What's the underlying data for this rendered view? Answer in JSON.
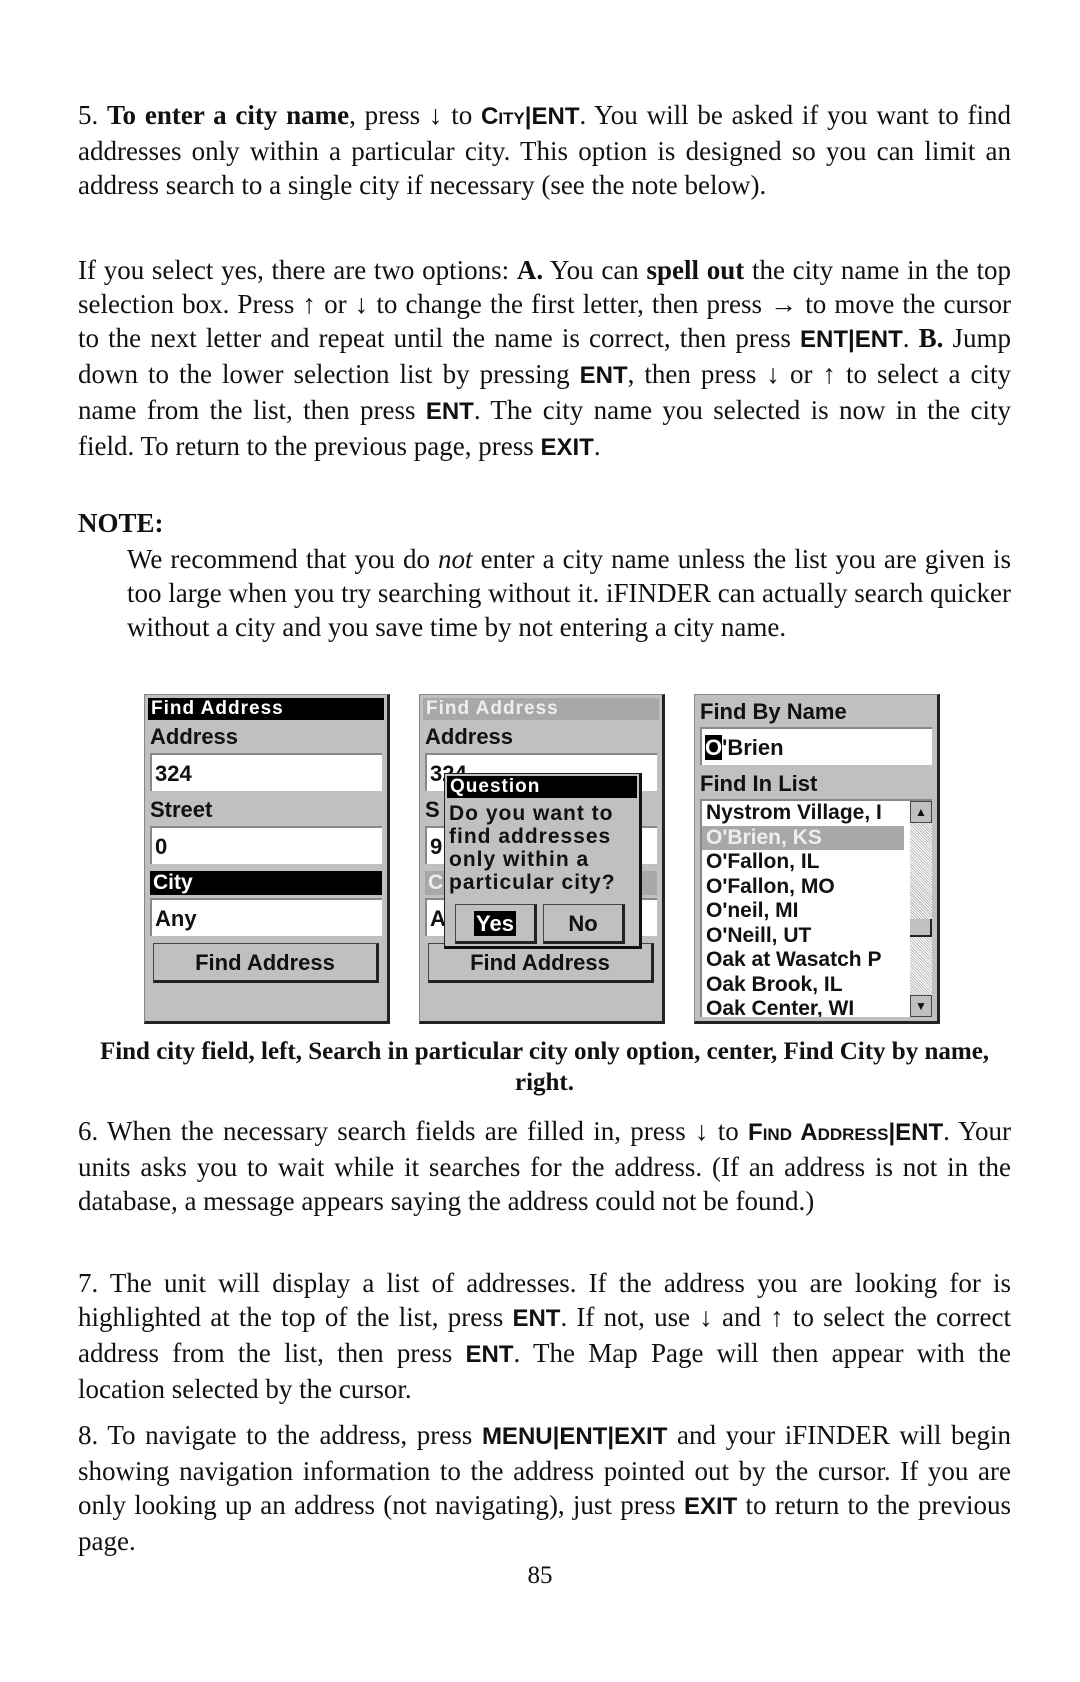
{
  "paragraphs": {
    "p5": [
      {
        "t": "5. "
      },
      {
        "t": "To enter a city name",
        "s": "b"
      },
      {
        "t": ", press ↓ to "
      },
      {
        "t": "City",
        "s": "sc"
      },
      {
        "t": "|",
        "s": "k"
      },
      {
        "t": "ENT",
        "s": "k"
      },
      {
        "t": ". You will be asked if you want to find addresses only within a particular city. This option is designed so you can limit an address search to a single city if necessary (see the note below)."
      }
    ],
    "p5b": [
      {
        "t": "If you select yes, there are two options: "
      },
      {
        "t": "A.",
        "s": "b"
      },
      {
        "t": " You can "
      },
      {
        "t": "spell out",
        "s": "b"
      },
      {
        "t": " the city name in the top selection box. Press ↑ or ↓ to change the first letter, then press → to move the cursor to the next letter and repeat until the name is correct, then press "
      },
      {
        "t": "ENT|ENT",
        "s": "k"
      },
      {
        "t": ". "
      },
      {
        "t": "B.",
        "s": "b"
      },
      {
        "t": " Jump down to the lower selection list by pressing "
      },
      {
        "t": "ENT",
        "s": "k"
      },
      {
        "t": ", then press ↓ or ↑ to select a city name from the list, then press "
      },
      {
        "t": "ENT",
        "s": "k"
      },
      {
        "t": ". The city name you selected is now in the city field. To return to the previous page, press "
      },
      {
        "t": "EXIT",
        "s": "k"
      },
      {
        "t": "."
      }
    ],
    "note_heading": "NOTE:",
    "note": [
      {
        "t": "We recommend that you do "
      },
      {
        "t": "not",
        "s": "i"
      },
      {
        "t": " enter a city name unless the list you are given is too large when you try searching without it. iFINDER can actually search quicker without a city and you save time by not entering a city name."
      }
    ],
    "caption": "Find city field, left, Search in particular city only option, center, Find City by name, right.",
    "p6": [
      {
        "t": "6. When the necessary search fields are filled in, press ↓ to "
      },
      {
        "t": "Find Address",
        "s": "sc"
      },
      {
        "t": "|",
        "s": "k"
      },
      {
        "t": "ENT",
        "s": "k"
      },
      {
        "t": ". Your units asks you to wait while it searches for the address. (If an address is not in the database, a message appears saying the address could not be found.)"
      }
    ],
    "p7": [
      {
        "t": "7. The unit will display a list of addresses. If the address you are looking for is highlighted at the top of the list, press "
      },
      {
        "t": "ENT",
        "s": "k"
      },
      {
        "t": ". If not, use ↓ and ↑ to select the correct address from the list, then press "
      },
      {
        "t": "ENT",
        "s": "k"
      },
      {
        "t": ". The Map Page will then appear with the location selected by the cursor."
      }
    ],
    "p8": [
      {
        "t": "8. To navigate to the address, press "
      },
      {
        "t": "MENU|ENT|EXIT",
        "s": "k"
      },
      {
        "t": " and your iFINDER will begin showing navigation information to the address pointed out by the cursor. If you are only looking up an address (not navigating), just press "
      },
      {
        "t": "EXIT",
        "s": "k"
      },
      {
        "t": " to return to the previous page."
      }
    ]
  },
  "page_number": "85",
  "screen_left": {
    "title": "Find Address",
    "address_label": "Address",
    "address_value": "324",
    "street_label": "Street",
    "street_value": "0",
    "city_label": "City",
    "city_value": "Any",
    "button": "Find Address"
  },
  "screen_center": {
    "title": "Find Address",
    "address_label": "Address",
    "address_value": "324",
    "street_label": "S",
    "street_value": "9",
    "city_label": "C",
    "city_value": "A",
    "button": "Find Address",
    "dialog": {
      "title": "Question",
      "message": [
        "Do you want to",
        "find addresses",
        "only within a",
        "particular city?"
      ],
      "yes": "Yes",
      "no": "No",
      "selected": "Yes"
    }
  },
  "screen_right": {
    "name_label": "Find By Name",
    "name_cursor": "O",
    "name_rest": "'Brien",
    "list_label": "Find In List",
    "items": [
      "Nystrom Village, I",
      "O'Brien, KS",
      "O'Fallon, IL",
      "O'Fallon, MO",
      "O'neil, MI",
      "O'Neill, UT",
      "Oak at Wasatch P",
      "Oak Brook, IL",
      "Oak Center, WI"
    ],
    "selected_index": 1,
    "scroll_up_icon": "triangle-up",
    "scroll_down_icon": "triangle-down"
  }
}
